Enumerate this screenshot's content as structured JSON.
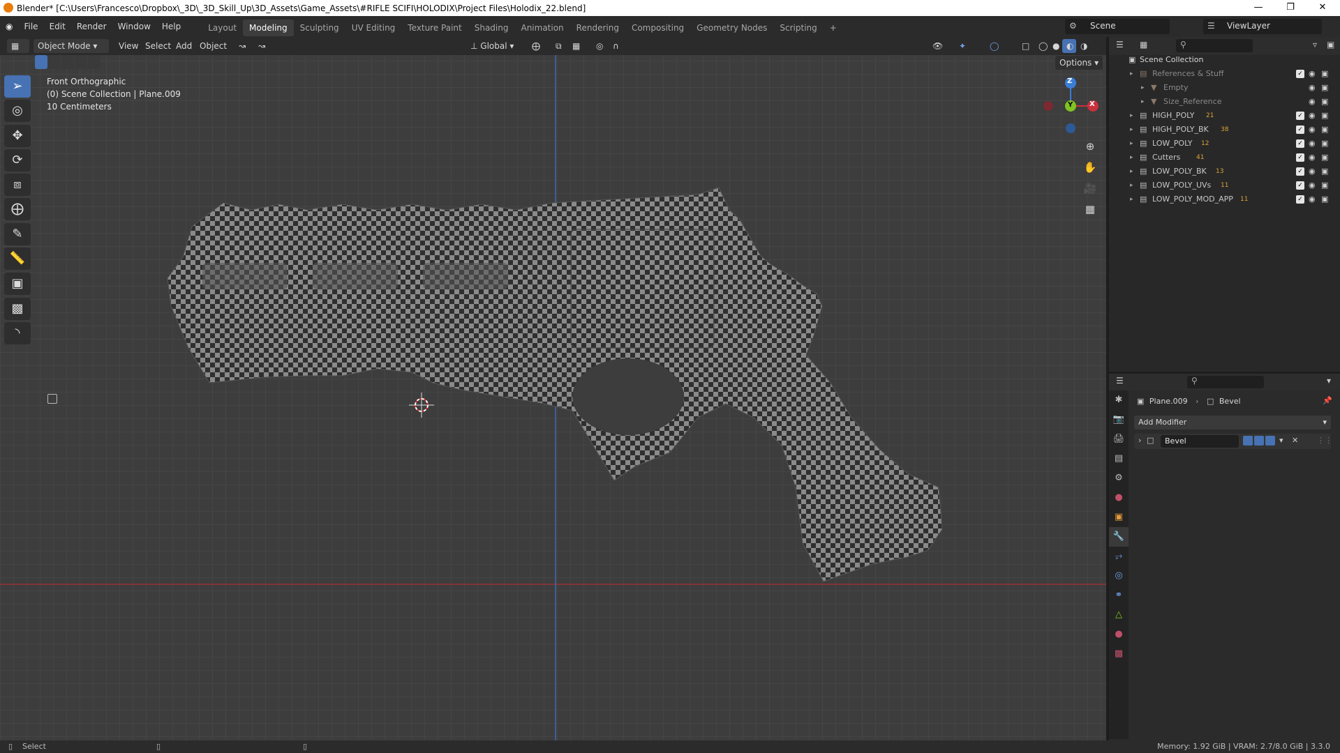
{
  "window": {
    "title": "Blender* [C:\\Users\\Francesco\\Dropbox\\_3D\\_3D_Skill_Up\\3D_Assets\\Game_Assets\\#RIFLE SCIFI\\HOLODIX\\Project Files\\Holodix_22.blend]"
  },
  "menus": [
    "File",
    "Edit",
    "Render",
    "Window",
    "Help"
  ],
  "workspaces": [
    "Layout",
    "Modeling",
    "Sculpting",
    "UV Editing",
    "Texture Paint",
    "Shading",
    "Animation",
    "Rendering",
    "Compositing",
    "Geometry Nodes",
    "Scripting"
  ],
  "active_workspace": "Modeling",
  "scene": {
    "name": "Scene",
    "view_layer": "ViewLayer"
  },
  "header": {
    "mode": "Object Mode",
    "view": "View",
    "select": "Select",
    "add": "Add",
    "object": "Object",
    "orientation": "Global",
    "options": "Options"
  },
  "viewport": {
    "view_name": "Front Orthographic",
    "collection_info": "(0) Scene Collection | Plane.009",
    "scale": "10 Centimeters",
    "gizmo": {
      "z": "Z",
      "y": "Y",
      "x": "X"
    }
  },
  "outliner": {
    "root": "Scene Collection",
    "items": [
      {
        "label": "References & Stuff",
        "indent": 1,
        "dim": true
      },
      {
        "label": "Empty",
        "indent": 2,
        "dim": true
      },
      {
        "label": "Size_Reference",
        "indent": 2,
        "dim": true
      },
      {
        "label": "HIGH_POLY",
        "indent": 1,
        "badge": "21"
      },
      {
        "label": "HIGH_POLY_BK",
        "indent": 1,
        "badge": "38"
      },
      {
        "label": "LOW_POLY",
        "indent": 1,
        "badge": "12"
      },
      {
        "label": "Cutters",
        "indent": 1,
        "badge": "41"
      },
      {
        "label": "LOW_POLY_BK",
        "indent": 1,
        "badge": "13"
      },
      {
        "label": "LOW_POLY_UVs",
        "indent": 1,
        "badge": "11"
      },
      {
        "label": "LOW_POLY_MOD_APP",
        "indent": 1,
        "badge": "11"
      }
    ]
  },
  "properties": {
    "object": "Plane.009",
    "modifier_crumb": "Bevel",
    "add_modifier": "Add Modifier",
    "modifier_name": "Bevel"
  },
  "statusbar": {
    "left": "Select",
    "right": "Memory: 1.92 GiB | VRAM: 2.7/8.0 GiB | 3.3.0"
  },
  "colors": {
    "accent": "#4772b3",
    "x_axis": "#c8303c",
    "y_axis": "#7fc321",
    "z_axis": "#3a7dd8"
  }
}
